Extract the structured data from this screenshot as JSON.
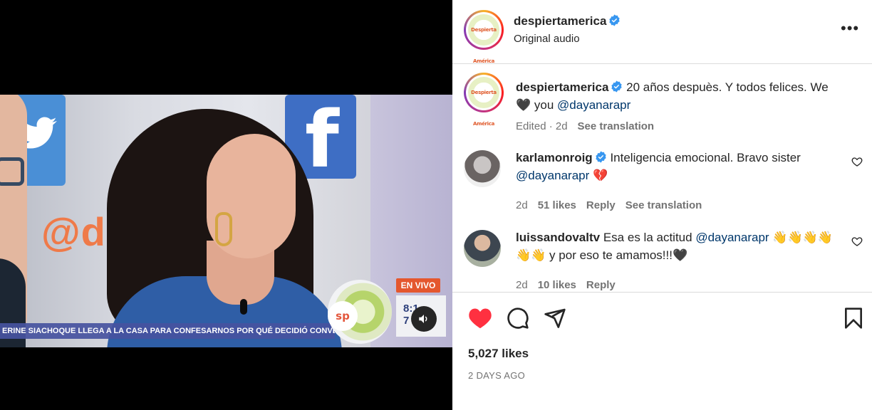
{
  "post": {
    "author": "despiertamerica",
    "audio": "Original audio",
    "avatar_text": "Despierta América",
    "more_label": "•••"
  },
  "video": {
    "wall_handle": "@de          am",
    "fb_glyph": "f",
    "ticker": "ERINE SIACHOQUE LLEGA A LA CASA PARA CONFESARNOS POR QUÉ DECIDIÓ CONVER",
    "live_badge": "EN VIVO",
    "clock": "8:1 7",
    "sp_badge": "sp"
  },
  "caption": {
    "author": "despiertamerica",
    "text_pre": "20 años despuès. Y todos felices. We ",
    "heart": "🖤",
    "text_mid": " you ",
    "mention": "@dayanarapr",
    "edited": "Edited · 2d",
    "translate": "See translation"
  },
  "comments": [
    {
      "author": "karlamonroig",
      "text": "Inteligencia emocional. Bravo sister ",
      "mention": "@dayanarapr",
      "emoji": " 💔",
      "time": "2d",
      "likes": "51 likes",
      "reply": "Reply",
      "translate": "See translation"
    },
    {
      "author": "luissandovaltv",
      "text_pre": "Esa es la actitud ",
      "mention": "@dayanarapr",
      "text_post": " 👋👋👋👋 👋👋 y por eso te amamos!!!🖤",
      "time": "2d",
      "likes": "10 likes",
      "reply": "Reply"
    }
  ],
  "stats": {
    "likes": "5,027 likes",
    "date": "2 DAYS AGO"
  },
  "colors": {
    "like_red": "#ff3040",
    "verified_blue": "#3897f0",
    "link": "#00376b",
    "muted": "#737373"
  },
  "icons": [
    "verified-badge-icon",
    "more-options-icon",
    "heart-icon",
    "comment-icon",
    "share-icon",
    "bookmark-icon",
    "speaker-icon"
  ]
}
